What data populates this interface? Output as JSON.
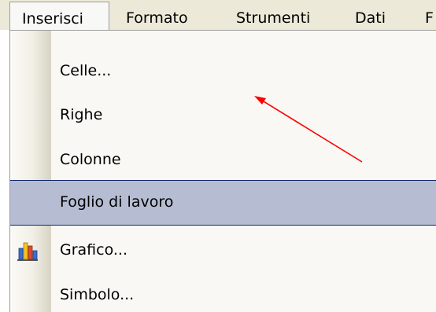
{
  "menubar": {
    "items": [
      {
        "label": "Inserisci",
        "open": true
      },
      {
        "label": "Formato"
      },
      {
        "label": "Strumenti"
      },
      {
        "label": "Dati"
      },
      {
        "label": "F"
      }
    ]
  },
  "dropdown": {
    "items": [
      {
        "label": "Celle...",
        "icon": null
      },
      {
        "label": "Righe",
        "icon": null
      },
      {
        "label": "Colonne",
        "icon": null
      },
      {
        "label": "Foglio di lavoro",
        "icon": null,
        "highlighted": true
      },
      {
        "label": "Grafico...",
        "icon": "chart-icon"
      },
      {
        "label": "Simbolo...",
        "icon": null
      }
    ]
  },
  "colors": {
    "menubar_bg": "#ece9d8",
    "highlight_bg": "#b6bdd2",
    "highlight_border": "#0a246a",
    "annotation_arrow": "#ff0000"
  }
}
